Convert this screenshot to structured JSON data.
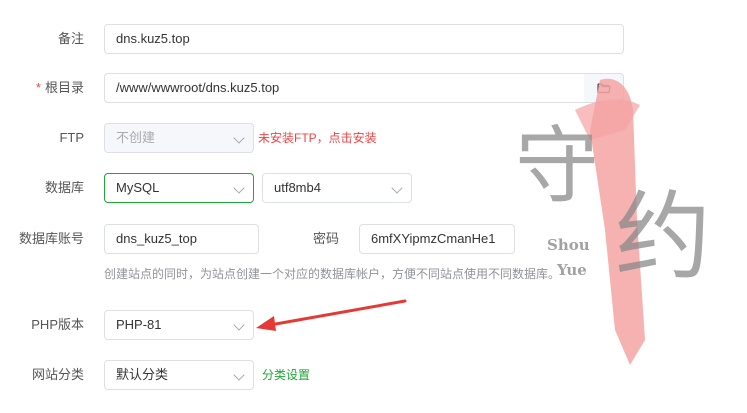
{
  "form": {
    "remark": {
      "label": "备注",
      "value": "dns.kuz5.top"
    },
    "root": {
      "required_mark": "*",
      "label": "根目录",
      "value": "/www/wwwroot/dns.kuz5.top"
    },
    "ftp": {
      "label": "FTP",
      "value": "不创建",
      "note": "未安装FTP，点击安装"
    },
    "database": {
      "label": "数据库",
      "type": "MySQL",
      "charset": "utf8mb4"
    },
    "db_account": {
      "label": "数据库账号",
      "value": "dns_kuz5_top",
      "password_label": "密码",
      "password_value": "6mfXYipmzCmanHe1",
      "hint": "创建站点的同时，为站点创建一个对应的数据库帐户，方便不同站点使用不同数据库。"
    },
    "php": {
      "label": "PHP版本",
      "value": "PHP-81"
    },
    "category": {
      "label": "网站分类",
      "value": "默认分类",
      "settings_link": "分类设置"
    }
  },
  "watermark": {
    "line1": "Shou",
    "line2": "Yue",
    "char1": "守",
    "char2": "约"
  },
  "colors": {
    "accent": "#20a53a",
    "warning": "#ef4444",
    "annotation_arrow": "#e53935"
  }
}
